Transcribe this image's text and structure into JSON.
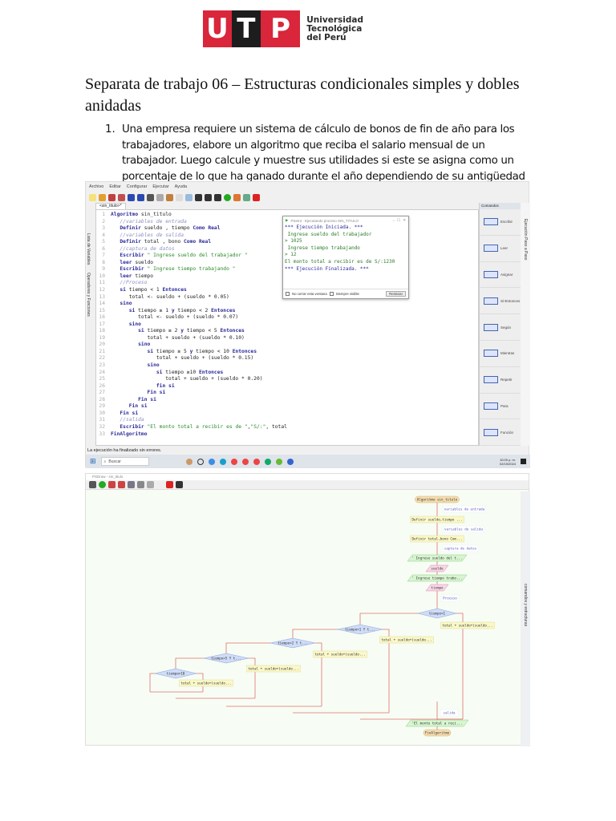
{
  "logo": {
    "letters": [
      "U",
      "T",
      "P"
    ],
    "name_lines": [
      "Universidad",
      "Tecnológica",
      "del Perú"
    ],
    "colors": {
      "red": "#d9263a",
      "black": "#1d1d1d"
    }
  },
  "title": "Separata de trabajo 06 – Estructuras condicionales simples y dobles anidadas",
  "exercise": {
    "number": "1.",
    "text": "Una empresa requiere un sistema de cálculo de bonos de fin de año para los trabajadores, elabore un algoritmo que reciba el salario mensual de un trabajador. Luego calcule y muestre sus utilidades si este se asigna como un porcentaje de lo que ha ganado durante el año dependiendo de su antigüedad en la empresa de acuerdo con la siguiente tabla:"
  },
  "pseint": {
    "window_title": "PSeInt",
    "menu": [
      "Archivo",
      "Editar",
      "Configurar",
      "Ejecutar",
      "Ayuda"
    ],
    "tab": "<sin_titulo>*",
    "left_panel": [
      "Lista de Variables",
      "Operadores y Funciones"
    ],
    "lines": [
      "Algoritmo sin_titulo",
      "   //variables de entrada",
      "   Definir sueldo , tiempo Como Real",
      "   //variables de salida",
      "   Definir total , bono Como Real",
      "   //captura de datos",
      "   Escribir \" Ingrese sueldo del trabajador \"",
      "   leer sueldo",
      "   Escribir \" Ingrese tiempo trabajando \"",
      "   leer tiempo",
      "   //Proceso",
      "   si tiempo < 1 Entonces",
      "      total <- sueldo + (sueldo * 0.05)",
      "   sino",
      "      si tiempo ≥ 1 y tiempo < 2 Entonces",
      "         total <- sueldo + (sueldo * 0.07)",
      "      sino",
      "         si tiempo ≥ 2 y tiempo < 5 Entonces",
      "            total + sueldo + (sueldo * 0.10)",
      "         sino",
      "            si tiempo ≥ 5 y tiempo < 10 Entonces",
      "               total + sueldo + (sueldo * 0.15)",
      "            sino",
      "               si tiempo ≥10 Entonces",
      "                  total + sueldo + (sueldo * 0.20)",
      "               fin si",
      "            Fin si",
      "         Fin si",
      "      Fin si",
      "   Fin si",
      "   //salida",
      "   Escribir \"El monto total a recibir es de \",\"S/:\", total",
      "FinAlgoritmo"
    ],
    "console": {
      "title": "PSeInt - Ejecutando proceso SIN_TITULO",
      "lines": [
        "*** Ejecución Iniciada. ***",
        " Ingrese sueldo del trabajador",
        "> 1025",
        " Ingrese tiempo trabajando",
        "> 12",
        "El monto total a recibir es de S/:1230",
        "*** Ejecución Finalizada. ***"
      ],
      "opt1": "No cerrar esta ventana",
      "opt2": "Siempre visible",
      "restart": "Reiniciar"
    },
    "palette": {
      "header": "Comandos",
      "items": [
        "Escribir",
        "Leer",
        "Asignar",
        "Si-Entonces",
        "Según",
        "Mientras",
        "Repetir",
        "Para",
        "Función"
      ]
    },
    "right_panel": "Ejecución Paso a Paso",
    "status": "La ejecución ha finalizado sin errores.",
    "taskbar": {
      "search": "Buscar",
      "time": "10:00 p. m.",
      "date": "02/15/2024"
    }
  },
  "flow": {
    "window_title": "PSDraw - sin_titulo",
    "right_panel": "comandos y estructuras",
    "nodes": {
      "start": "Algoritmo sin_titulo",
      "c1": "variables de entrada",
      "d1": "Definir sueldo,tiempo ...",
      "c2": "variables de salida",
      "d2": "Definir total,bono Com...",
      "c3": "captura de datos",
      "w1": "' Ingrese sueldo del t...",
      "r1": "sueldo",
      "w2": "' Ingrese tiempo trabo...",
      "r2": "tiempo",
      "c4": "Proceso",
      "q1": "tiempo<1",
      "a1": "total + sueldo+(sueldo...",
      "q2": "tiempo>1 Y t...",
      "a2": "total + sueldo+(sueldo...",
      "q3": "tiempo>2 Y t...",
      "a3": "total + sueldo+(sueldo...",
      "q4": "tiempo>5 Y t...",
      "a4": "total + sueldo+(sueldo...",
      "q5": "tiempo>10",
      "a5": "total + sueldo+(sueldo...",
      "c5": "salida",
      "w3": "'El monto total a reci...",
      "end": "FinAlgoritmo"
    }
  }
}
